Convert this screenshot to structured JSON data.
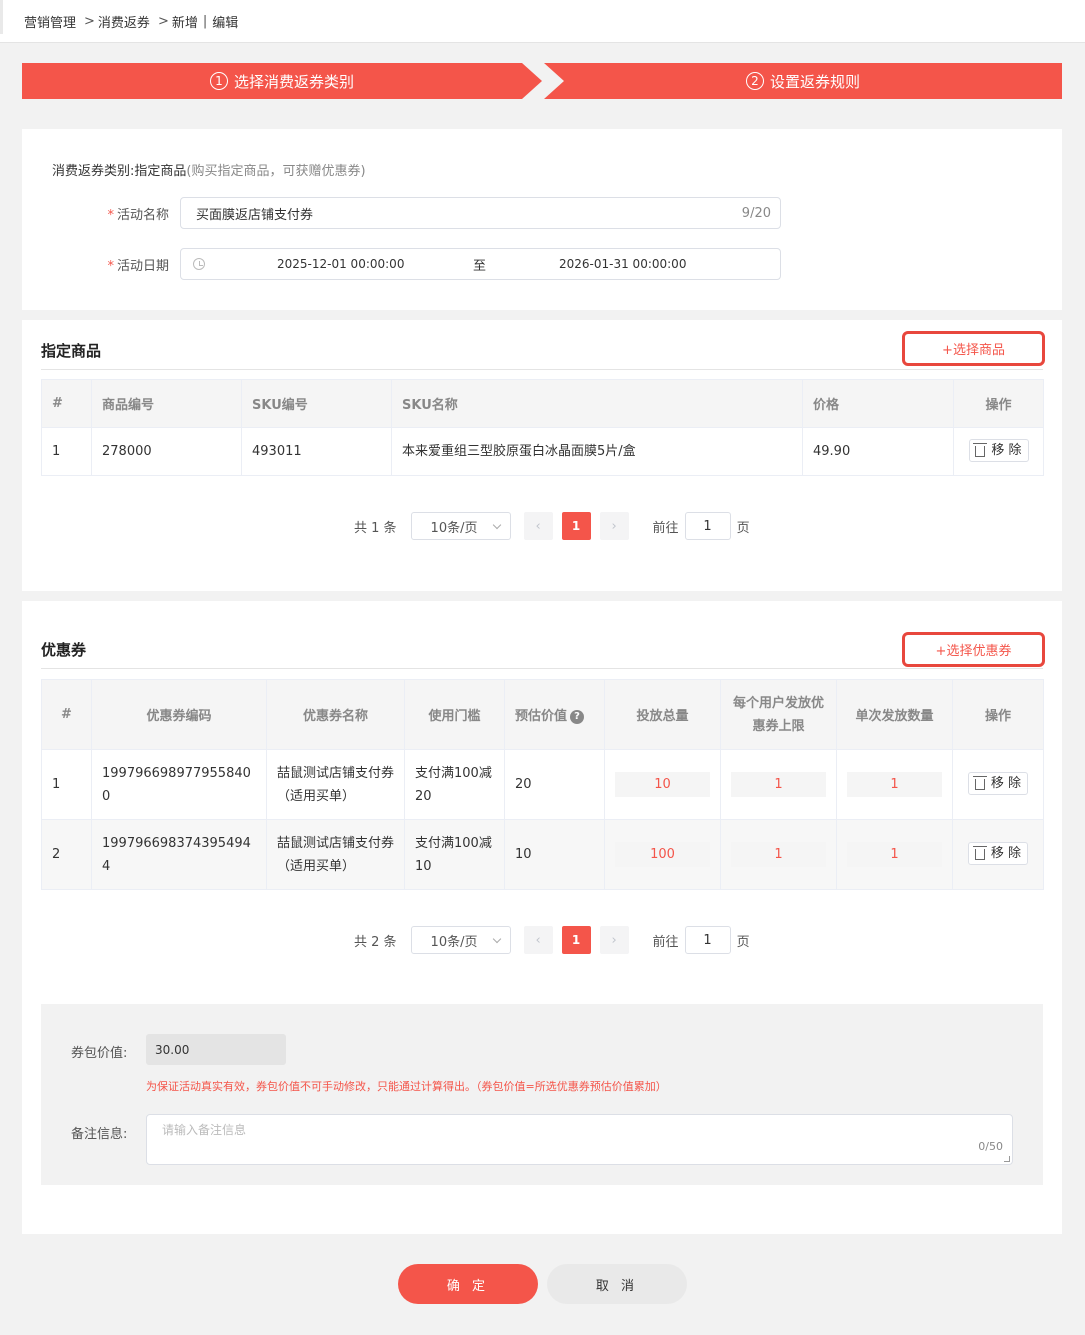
{
  "breadcrumb": {
    "items": [
      "营销管理",
      "消费返券",
      "新增",
      "编辑"
    ],
    "sep": ">",
    "bar": "|"
  },
  "steps": [
    {
      "num": "1",
      "label": "选择消费返券类别"
    },
    {
      "num": "2",
      "label": "设置返券规则"
    }
  ],
  "basic": {
    "type_label": "消费返券类别:",
    "type_value": "指定商品",
    "type_hint": "(购买指定商品，可获赠优惠券)",
    "required_mark": "*",
    "name_label": "活动名称",
    "name_value": "买面膜返店铺支付券",
    "name_count": "9/20",
    "date_label": "活动日期",
    "date_start": "2025-12-01 00:00:00",
    "date_to": "至",
    "date_end": "2026-01-31 00:00:00"
  },
  "goods": {
    "title": "指定商品",
    "add_button": "+选择商品",
    "columns": [
      "#",
      "商品编号",
      "SKU编号",
      "SKU名称",
      "价格",
      "操作"
    ],
    "rows": [
      {
        "idx": "1",
        "goods_no": "278000",
        "sku_no": "493011",
        "sku_name": "本来爱重组三型胶原蛋白冰晶面膜5片/盒",
        "price": "49.90",
        "action": "移 除"
      }
    ],
    "pager": {
      "total": "共 1 条",
      "size": "10条/页",
      "page": "1",
      "goto": "前往",
      "jump": "1",
      "unit": "页",
      "prev": "‹",
      "next": "›"
    }
  },
  "coupon": {
    "title": "优惠券",
    "add_button": "+选择优惠券",
    "columns": [
      "#",
      "优惠券编码",
      "优惠券名称",
      "使用门槛",
      "预估价值",
      "投放总量",
      "每个用户发放优惠券上限",
      "单次发放数量",
      "操作"
    ],
    "help": "?",
    "rows": [
      {
        "idx": "1",
        "code": "1997966989779558400",
        "name": "喆鼠测试店铺支付券（适用买单）",
        "threshold": "支付满100减20",
        "value": "20",
        "total": "10",
        "limit": "1",
        "per": "1",
        "action": "移 除"
      },
      {
        "idx": "2",
        "code": "1997966983743954944",
        "name": "喆鼠测试店铺支付券（适用买单）",
        "threshold": "支付满100减10",
        "value": "10",
        "total": "100",
        "limit": "1",
        "per": "1",
        "action": "移 除"
      }
    ],
    "pager": {
      "total": "共 2 条",
      "size": "10条/页",
      "page": "1",
      "goto": "前往",
      "jump": "1",
      "unit": "页",
      "prev": "‹",
      "next": "›"
    }
  },
  "summary": {
    "package_label": "券包价值:",
    "package_value": "30.00",
    "warning": "为保证活动真实有效，券包价值不可手动修改，只能通过计算得出。（券包价值=所选优惠券预估价值累加）",
    "remark_label": "备注信息:",
    "remark_placeholder": "请输入备注信息",
    "remark_count": "0/50"
  },
  "actions": {
    "confirm": "确 定",
    "cancel": "取 消"
  },
  "colors": {
    "accent": "#f4554a",
    "highlight_frame": "#e8473d"
  }
}
